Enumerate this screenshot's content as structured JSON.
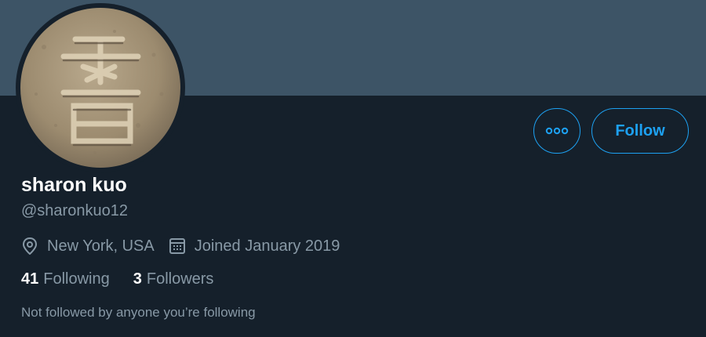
{
  "profile": {
    "name": "sharon kuo",
    "handle": "@sharonkuo12",
    "location": "New York, USA",
    "joined": "Joined January 2019",
    "following_count": "41",
    "following_label": "Following",
    "followers_count": "3",
    "followers_label": "Followers",
    "followed_by_note": "Not followed by anyone you’re following"
  },
  "actions": {
    "more_label": "•••",
    "follow_label": "Follow"
  },
  "colors": {
    "background": "#15202b",
    "banner": "#3d5466",
    "accent": "#1da1f2",
    "secondary_text": "#8899a6"
  },
  "icons": {
    "location": "location-pin-icon",
    "joined": "calendar-icon",
    "more": "more-options-icon"
  }
}
